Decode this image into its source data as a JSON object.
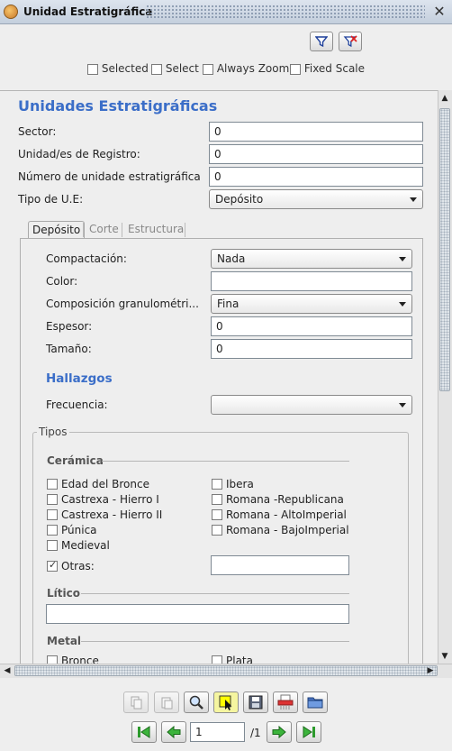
{
  "window": {
    "title": "Unidad Estratigráfica"
  },
  "toolbar": {
    "checkboxes": [
      {
        "label": "Selected",
        "checked": false
      },
      {
        "label": "Select",
        "checked": false
      },
      {
        "label": "Always Zoom",
        "checked": false
      },
      {
        "label": "Fixed Scale",
        "checked": false
      }
    ]
  },
  "form": {
    "heading": "Unidades Estratigráficas",
    "sector": {
      "label": "Sector:",
      "value": "0"
    },
    "registro": {
      "label": "Unidad/es de Registro:",
      "value": "0"
    },
    "numero": {
      "label": "Número de unidade estratigráfica",
      "value": "0"
    },
    "tipo": {
      "label": "Tipo de U.E:",
      "value": "Depósito"
    }
  },
  "tabs": [
    "Depósito",
    "Corte",
    "Estructura"
  ],
  "deposito": {
    "compactacion": {
      "label": "Compactación:",
      "value": "Nada"
    },
    "color": {
      "label": "Color:",
      "value": ""
    },
    "composicion": {
      "label": "Composición granulométri...",
      "value": "Fina"
    },
    "espesor": {
      "label": "Espesor:",
      "value": "0"
    },
    "tamano": {
      "label": "Tamaño:",
      "value": "0"
    },
    "hallazgos": "Hallazgos",
    "frecuencia": {
      "label": "Frecuencia:",
      "value": ""
    },
    "tipos": "Tipos",
    "ceramica": {
      "title": "Cerámica",
      "left": [
        {
          "label": "Edad del Bronce",
          "checked": false
        },
        {
          "label": "Castrexa - Hierro I",
          "checked": false
        },
        {
          "label": "Castrexa - Hierro II",
          "checked": false
        },
        {
          "label": "Púnica",
          "checked": false
        },
        {
          "label": "Medieval",
          "checked": false
        }
      ],
      "right": [
        {
          "label": "Ibera",
          "checked": false
        },
        {
          "label": "Romana -Republicana",
          "checked": false
        },
        {
          "label": "Romana - AltoImperial",
          "checked": false
        },
        {
          "label": "Romana - BajoImperial",
          "checked": false
        }
      ],
      "otras": {
        "label": "Otras:",
        "checked": true,
        "value": ""
      }
    },
    "litico": {
      "title": "Lítico",
      "value": ""
    },
    "metal": {
      "title": "Metal",
      "left": "Bronce",
      "right": "Plata"
    }
  },
  "navigation": {
    "page": "1",
    "total": "/1"
  }
}
